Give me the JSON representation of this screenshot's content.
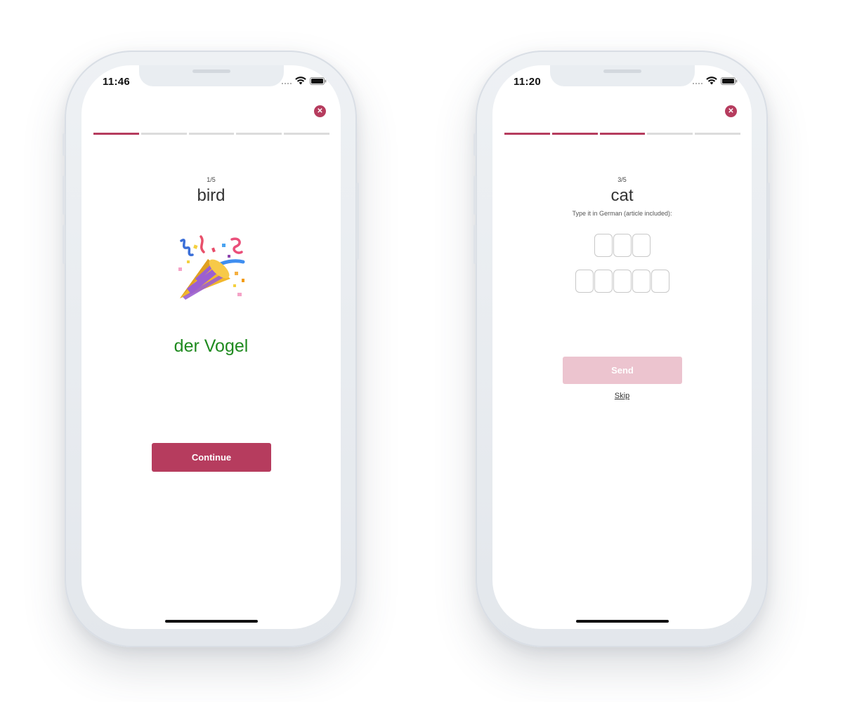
{
  "colors": {
    "accent": "#b63c5e",
    "accent_light": "#ecc4cf",
    "correct": "#1f8a1f",
    "track": "#dcdcdc"
  },
  "phone_left": {
    "status": {
      "time": "11:46",
      "icons": [
        "signal-dots-icon",
        "wifi-icon",
        "battery-icon"
      ]
    },
    "close_icon": "close-icon",
    "progress": {
      "total": 5,
      "completed": 1
    },
    "counter": "1/5",
    "word": "bird",
    "emoji": "party-popper-icon",
    "answer": "der Vogel",
    "continue_label": "Continue"
  },
  "phone_right": {
    "status": {
      "time": "11:20",
      "icons": [
        "signal-dots-icon",
        "wifi-icon",
        "battery-icon"
      ]
    },
    "close_icon": "close-icon",
    "progress": {
      "total": 5,
      "completed": 3
    },
    "counter": "3/5",
    "word": "cat",
    "instruction": "Type it in German (article included):",
    "letter_rows": [
      3,
      5
    ],
    "send_label": "Send",
    "skip_label": "Skip"
  }
}
